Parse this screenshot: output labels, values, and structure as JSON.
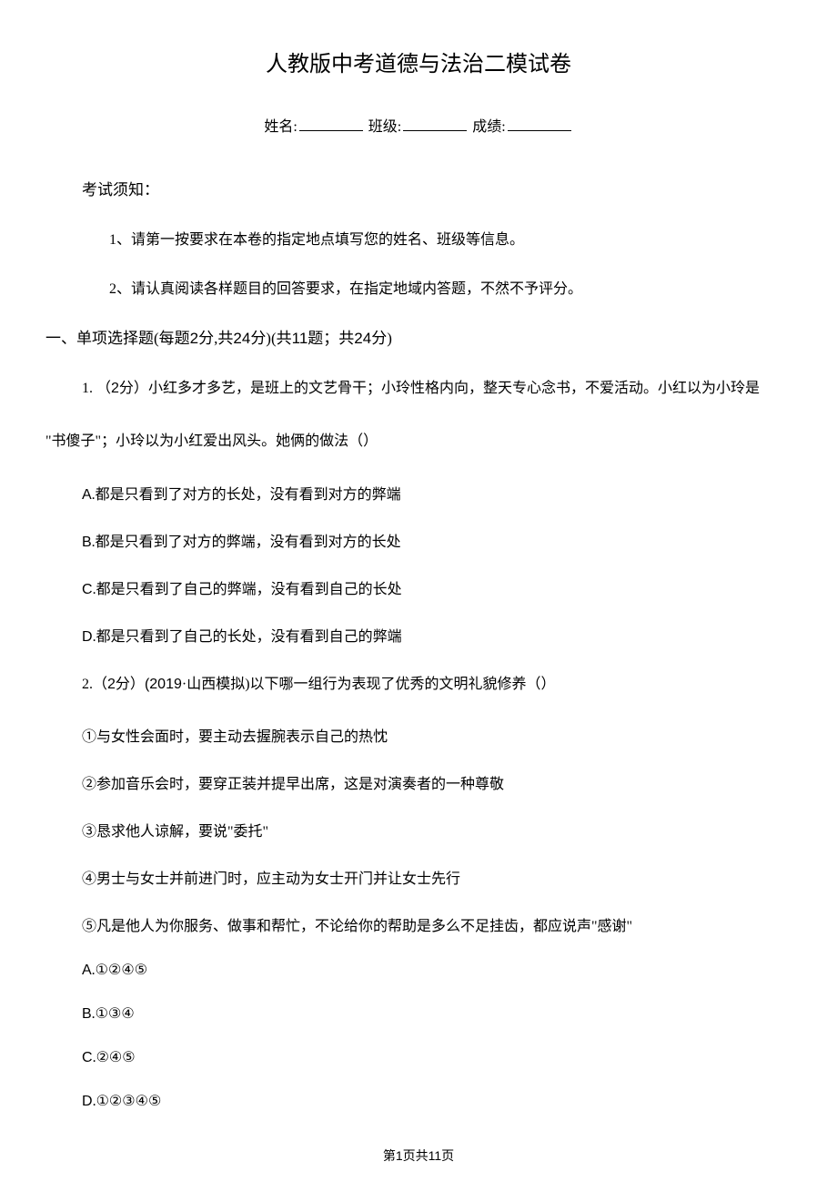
{
  "title": "人教版中考道德与法治二模试卷",
  "form": {
    "name_label": "姓名:",
    "class_label": "班级:",
    "score_label": "成绩:"
  },
  "notice": {
    "header": "考试须知：",
    "items": [
      "1、请第一按要求在本卷的指定地点填写您的姓名、班级等信息。",
      "2、请认真阅读各样题目的回答要求，在指定地域内答题，不然不予评分。"
    ]
  },
  "section": {
    "prefix": "一、单项选择题(每题",
    "points_per": "2",
    "mid1": "分,共",
    "total_points": "24",
    "mid2": "分)(共",
    "count": "11",
    "mid3": "题；共",
    "total_points2": "24",
    "suffix": "分)"
  },
  "q1": {
    "num_prefix": "1. （",
    "points": "2",
    "num_suffix": "分）",
    "text_part1": "小红多才多艺，是班上的文艺骨干；小玲性格内向，整天专心念书，不爱活动。小红以为小玲是",
    "text_part2": "\"书傻子\"；小玲以为小红爱出风头。她俩的做法（）",
    "options": {
      "A": ".都是只看到了对方的长处，没有看到对方的弊端",
      "B": ".都是只看到了对方的弊端，没有看到对方的长处",
      "C": ".都是只看到了自己的弊端，没有看到自己的长处",
      "D": ".都是只看到了自己的长处，没有看到自己的弊端"
    }
  },
  "q2": {
    "num_prefix": "2.（",
    "points": "2",
    "num_suffix": "分）",
    "source_prefix": "(2019",
    "source_suffix": "·山西模拟)",
    "text": "以下哪一组行为表现了优秀的文明礼貌修养（）",
    "statements": [
      "①与女性会面时，要主动去握腕表示自己的热忱",
      "②参加音乐会时，要穿正装并提早出席，这是对演奏者的一种尊敬",
      "③恳求他人谅解，要说\"委托\"",
      "④男士与女士并前进门时，应主动为女士开门并让女士先行",
      "⑤凡是他人为你服务、做事和帮忙，不论给你的帮助是多么不足挂齿，都应说声\"感谢\""
    ],
    "options": {
      "A": ".①②④⑤",
      "B": ".①③④",
      "C": ".②④⑤",
      "D": ".①②③④⑤"
    }
  },
  "footer": {
    "prefix": "第",
    "current": "1",
    "mid": "页共",
    "total": "11",
    "suffix": "页"
  }
}
